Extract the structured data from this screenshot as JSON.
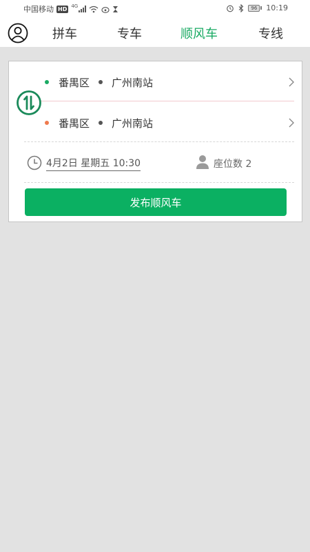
{
  "status_bar": {
    "carrier": "中国移动",
    "hd": "HD",
    "network": "4G",
    "battery": "96",
    "time": "10:19"
  },
  "header": {
    "tabs": [
      {
        "label": "拼车",
        "active": false
      },
      {
        "label": "专车",
        "active": false
      },
      {
        "label": "顺风车",
        "active": true
      },
      {
        "label": "专线",
        "active": false
      }
    ]
  },
  "trip": {
    "start": {
      "district": "番禺区",
      "station": "广州南站"
    },
    "end": {
      "district": "番禺区",
      "station": "广州南站"
    },
    "datetime": "4月2日 星期五 10:30",
    "seats_label": "座位数 2",
    "publish_label": "发布顺风车"
  },
  "colors": {
    "accent": "#1aaa63",
    "button": "#0bb062",
    "start_dot": "#1aaa63",
    "end_dot": "#ef7a4d",
    "background": "#e2e2e2"
  },
  "icons": {
    "avatar": "user-circle-icon",
    "swap": "swap-route-icon",
    "chevron": "chevron-right-icon",
    "clock": "clock-icon",
    "seat": "person-icon"
  }
}
